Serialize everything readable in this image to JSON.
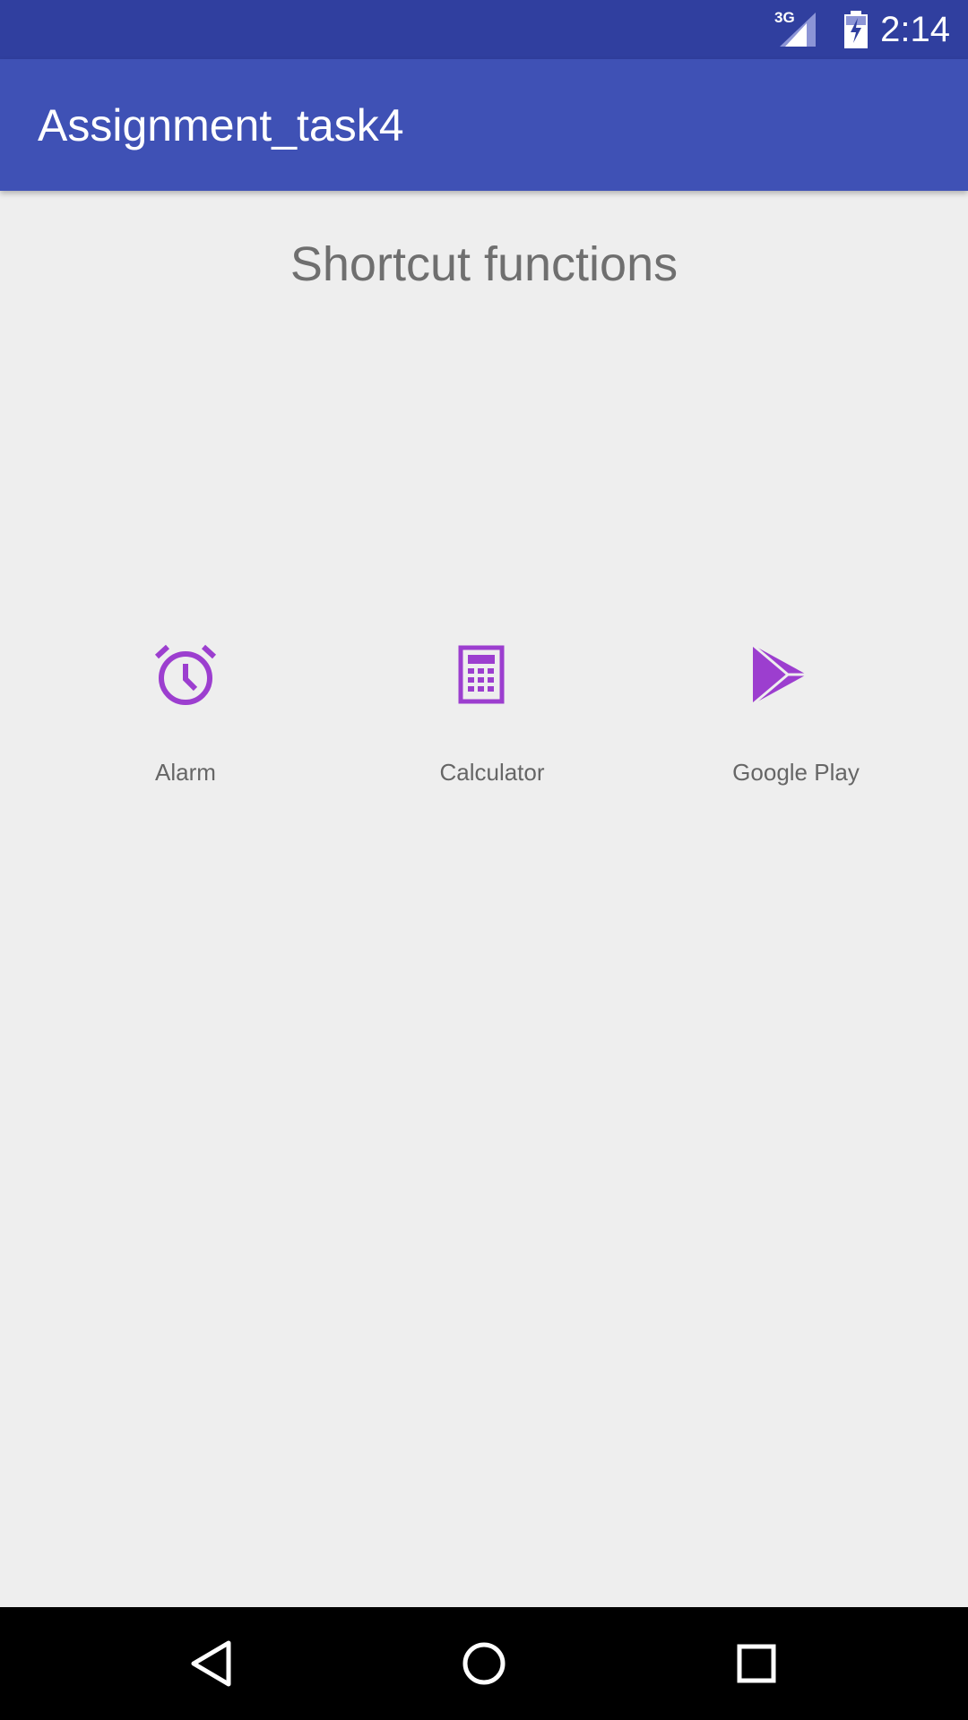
{
  "status_bar": {
    "network": "3G",
    "time": "2:14"
  },
  "app_bar": {
    "title": "Assignment_task4"
  },
  "main": {
    "section_title": "Shortcut functions",
    "shortcuts": [
      {
        "label": "Alarm",
        "icon": "alarm-icon"
      },
      {
        "label": "Calculator",
        "icon": "calculator-icon"
      },
      {
        "label": "Google Play",
        "icon": "google-play-icon"
      }
    ]
  },
  "nav_bar": {
    "buttons": [
      "back-icon",
      "home-icon",
      "recents-icon"
    ]
  },
  "colors": {
    "status_bar": "#303f9f",
    "app_bar": "#3f51b5",
    "icon_accent": "#9c3ecf",
    "background": "#eeeeee"
  }
}
